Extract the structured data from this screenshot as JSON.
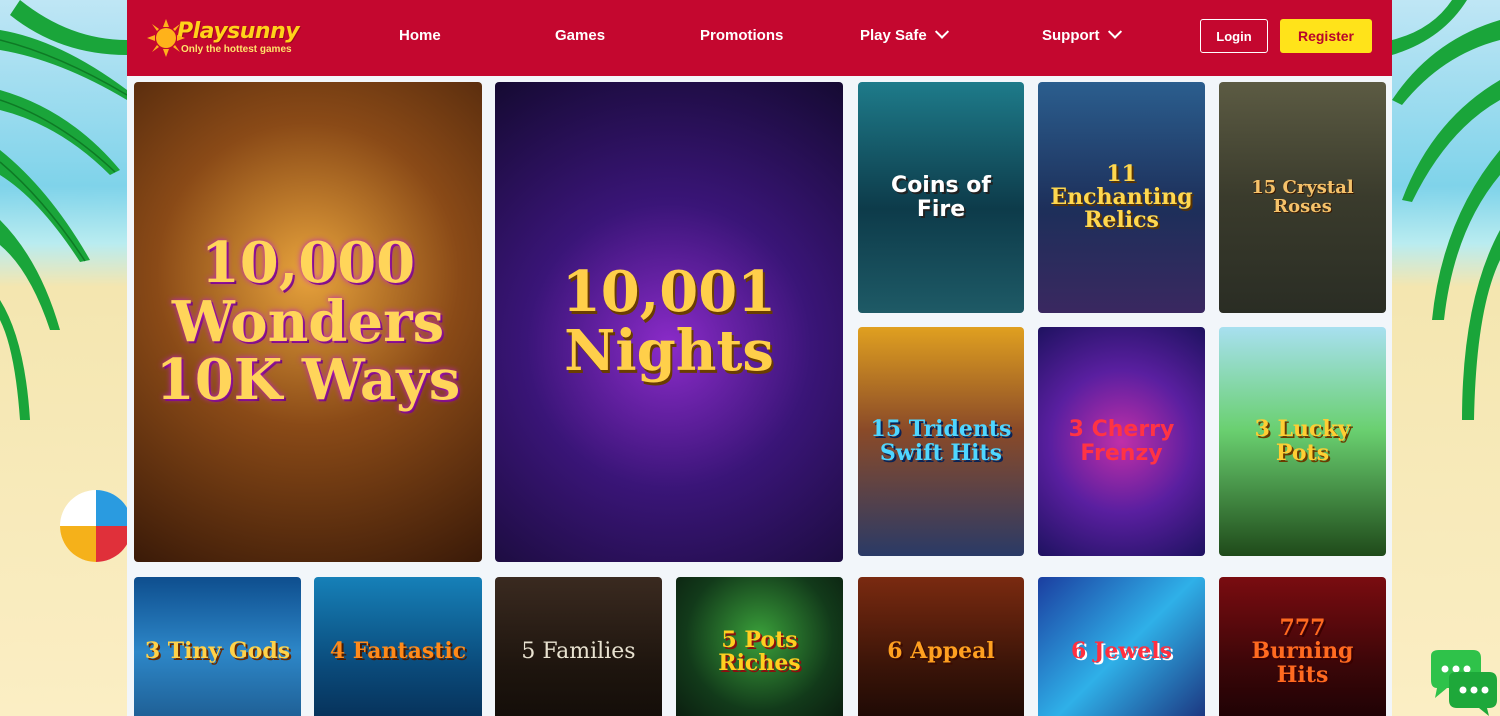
{
  "brand": {
    "name": "Playsunny",
    "tagline": "Only the hottest games",
    "primary_color": "#c4072f",
    "accent_color": "#ffe31a"
  },
  "nav": {
    "items": [
      {
        "label": "Home",
        "has_dropdown": false
      },
      {
        "label": "Games",
        "has_dropdown": false
      },
      {
        "label": "Promotions",
        "has_dropdown": false
      },
      {
        "label": "Play Safe",
        "has_dropdown": true
      },
      {
        "label": "Support",
        "has_dropdown": true
      }
    ],
    "login_label": "Login",
    "register_label": "Register"
  },
  "games": [
    {
      "title": "10,000 Wonders 10K Ways"
    },
    {
      "title": "10,001 Nights"
    },
    {
      "title": "Coins of Fire"
    },
    {
      "title": "11 Enchanting Relics"
    },
    {
      "title": "15 Crystal Roses"
    },
    {
      "title": "15 Tridents Swift Hits"
    },
    {
      "title": "3 Cherry Frenzy"
    },
    {
      "title": "3 Lucky Pots"
    },
    {
      "title": "3 Tiny Gods"
    },
    {
      "title": "4 Fantastic"
    },
    {
      "title": "5 Families"
    },
    {
      "title": "5 Pots Riches"
    },
    {
      "title": "6 Appeal"
    },
    {
      "title": "6 Jewels"
    },
    {
      "title": "777 Burning Hits"
    }
  ],
  "icons": {
    "chat": "chat-bubbles-icon",
    "chevron": "chevron-down-icon",
    "logo_sun": "sun-icon"
  }
}
